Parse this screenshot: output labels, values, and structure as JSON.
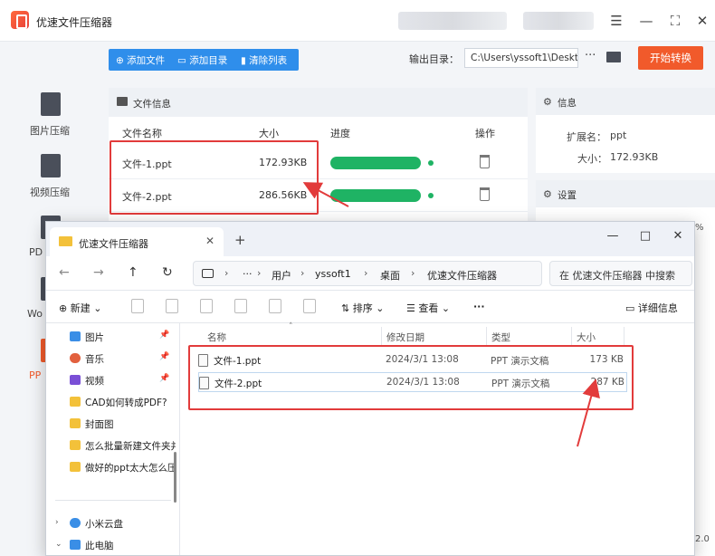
{
  "app": {
    "title": "优速文件压缩器",
    "sidebar": [
      {
        "label": "图片压缩",
        "icon": "image-compress-icon"
      },
      {
        "label": "视频压缩",
        "icon": "video-compress-icon"
      },
      {
        "label": "PD",
        "icon": "pdf-compress-icon"
      },
      {
        "label": "Wo",
        "icon": "word-compress-icon"
      },
      {
        "label": "PP",
        "icon": "ppt-compress-icon"
      }
    ],
    "toolbar": {
      "add_file": "添加文件",
      "add_dir": "添加目录",
      "clear_list": "清除列表"
    },
    "output_label": "输出目录：",
    "output_path": "C:\\Users\\yssoft1\\Deskt",
    "path_more": "···",
    "start_button": "开始转换",
    "file_panel": {
      "title": "文件信息",
      "columns": {
        "name": "文件名称",
        "size": "大小",
        "progress": "进度",
        "action": "操作"
      },
      "files": [
        {
          "name": "文件-1.ppt",
          "size": "172.93KB",
          "progress": 1.0
        },
        {
          "name": "文件-2.ppt",
          "size": "286.56KB",
          "progress": 1.0
        }
      ]
    },
    "info_panel": {
      "title": "信息",
      "ext_label": "扩展名：",
      "ext_value": "ppt",
      "size_label": "大小：",
      "size_value": "172.93KB"
    },
    "settings_panel": {
      "title": "设置",
      "fragment": "%"
    },
    "version_fragment": "2.0",
    "accent_color": "#f15a2b",
    "progress_color": "#1fb364",
    "highlight_color": "#e23b3b"
  },
  "explorer": {
    "tab_title": "优速文件压缩器",
    "window_controls": {
      "minimize": "—",
      "maximize": "□",
      "close": "✕"
    },
    "breadcrumb": [
      "···",
      "用户",
      "yssoft1",
      "桌面",
      "优速文件压缩器"
    ],
    "search_placeholder": "在 优速文件压缩器 中搜索",
    "commands": {
      "new": "新建",
      "sort": "排序",
      "view": "查看",
      "more": "···",
      "details": "详细信息"
    },
    "nav_items": [
      {
        "label": "图片",
        "icon": "pictures-icon",
        "pinned": true
      },
      {
        "label": "音乐",
        "icon": "music-icon",
        "pinned": true
      },
      {
        "label": "视频",
        "icon": "videos-icon",
        "pinned": true
      },
      {
        "label": "CAD如何转成PDF?",
        "icon": "folder-icon",
        "pinned": false
      },
      {
        "label": "封面图",
        "icon": "folder-icon",
        "pinned": false
      },
      {
        "label": "怎么批量新建文件夹并",
        "icon": "folder-icon",
        "pinned": false
      },
      {
        "label": "做好的ppt太大怎么压",
        "icon": "folder-icon",
        "pinned": false
      }
    ],
    "nav_bottom": [
      {
        "label": "小米云盘",
        "icon": "cloud-icon"
      },
      {
        "label": "此电脑",
        "icon": "this-pc-icon"
      }
    ],
    "columns": {
      "name": "名称",
      "date": "修改日期",
      "type": "类型",
      "size": "大小"
    },
    "files": [
      {
        "name": "文件-1.ppt",
        "date": "2024/3/1 13:08",
        "type": "PPT 演示文稿",
        "size": "173 KB"
      },
      {
        "name": "文件-2.ppt",
        "date": "2024/3/1 13:08",
        "type": "PPT 演示文稿",
        "size": "287 KB"
      }
    ]
  }
}
